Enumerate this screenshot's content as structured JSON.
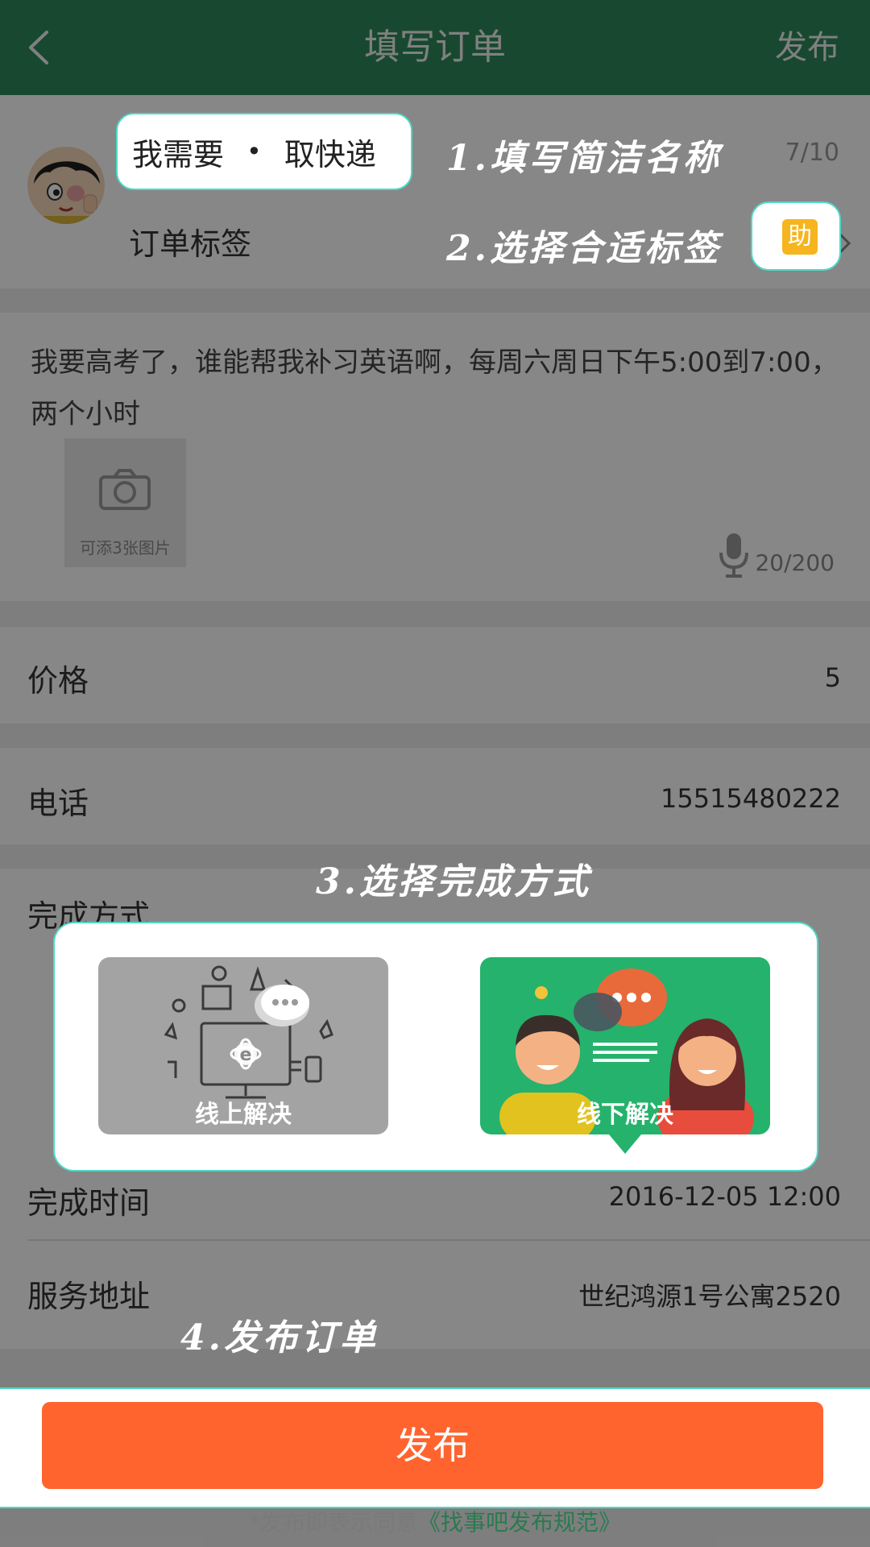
{
  "header": {
    "title": "填写订单",
    "publish": "发布"
  },
  "order": {
    "name_prefix": "我需要",
    "name_separator": "•",
    "name_value": "取快递",
    "name_count": "7/10",
    "tag_label": "订单标签",
    "tag_badge": "助",
    "description": "我要高考了，谁能帮我补习英语啊，每周六周日下午5:00到7:00，两个小时",
    "photo_hint": "可添3张图片",
    "desc_count": "20/200"
  },
  "fields": {
    "price_label": "价格",
    "price_value": "5",
    "phone_label": "电话",
    "phone_value": "15515480222",
    "mode_label": "完成方式",
    "time_label": "完成时间",
    "time_value": "2016-12-05  12:00",
    "address_label": "服务地址",
    "address_value": "世纪鸿源1号公寓2520"
  },
  "modes": {
    "online": "线上解决",
    "offline": "线下解决"
  },
  "steps": {
    "step1": "1.填写简洁名称",
    "step2": "2.选择合适标签",
    "step3": "3.选择完成方式",
    "step4": "4.发布订单"
  },
  "footer": {
    "publish_button": "发布",
    "agree_text": "*发布即表示同意",
    "agree_link": "《找事吧发布规范》"
  },
  "colors": {
    "header": "#2f8a5c",
    "highlight_border": "#4fd8c6",
    "publish_button": "#ff642f",
    "offline_card": "#25b26c",
    "tag_badge": "#f6b51e"
  },
  "icons": [
    "back-icon",
    "camera-icon",
    "mic-icon",
    "chevron-right-icon"
  ]
}
